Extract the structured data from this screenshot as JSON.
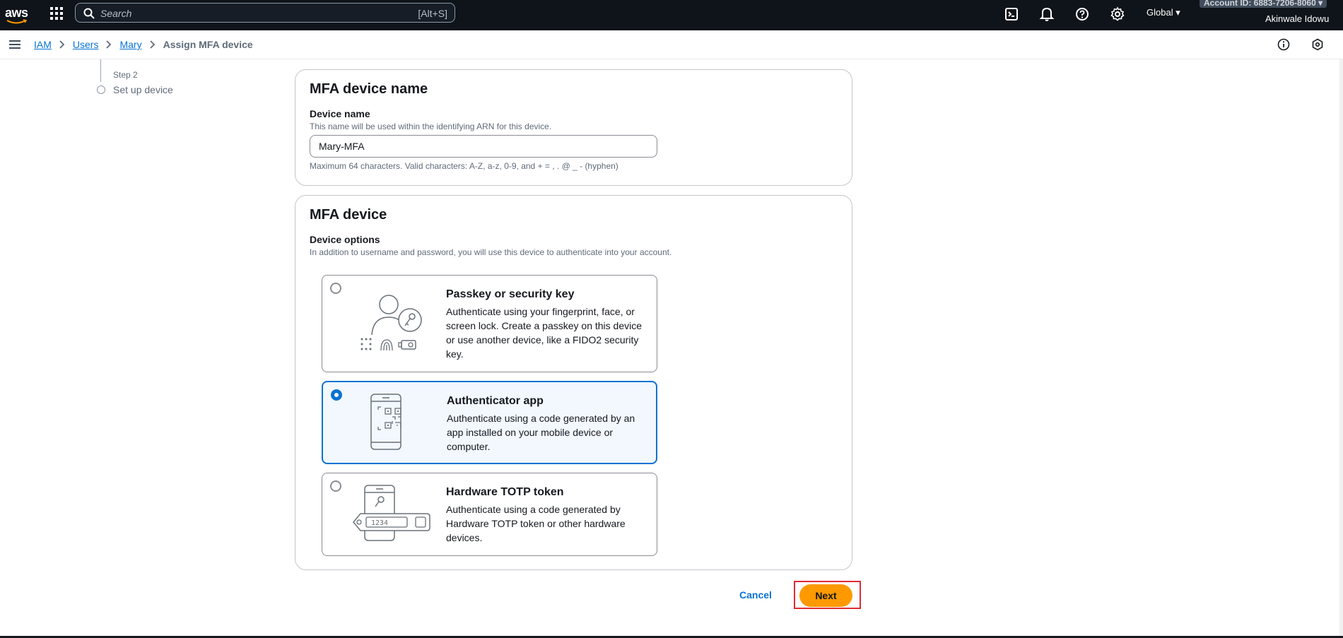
{
  "topnav": {
    "logo_text": "aws",
    "search_placeholder": "Search",
    "search_shortcut": "[Alt+S]",
    "region": "Global ▾",
    "account": "Account ID: 6883-7206-8060 ▾",
    "user": "Akinwale Idowu"
  },
  "breadcrumb": {
    "items": [
      "IAM",
      "Users",
      "Mary"
    ],
    "current": "Assign MFA device"
  },
  "steps": {
    "step_label": "Step 2",
    "step_title": "Set up device"
  },
  "device_name_panel": {
    "heading": "MFA device name",
    "label": "Device name",
    "description": "This name will be used within the identifying ARN for this device.",
    "value": "Mary-MFA",
    "constraint": "Maximum 64 characters. Valid characters: A-Z, a-z, 0-9, and + = , . @ _ - (hyphen)"
  },
  "device_panel": {
    "heading": "MFA device",
    "label": "Device options",
    "description": "In addition to username and password, you will use this device to authenticate into your account.",
    "options": [
      {
        "title": "Passkey or security key",
        "description": "Authenticate using your fingerprint, face, or screen lock. Create a passkey on this device or use another device, like a FIDO2 security key.",
        "selected": false
      },
      {
        "title": "Authenticator app",
        "description": "Authenticate using a code generated by an app installed on your mobile device or computer.",
        "selected": true
      },
      {
        "title": "Hardware TOTP token",
        "description": "Authenticate using a code generated by Hardware TOTP token or other hardware devices.",
        "selected": false
      }
    ],
    "token_display": "1234"
  },
  "actions": {
    "cancel": "Cancel",
    "next": "Next"
  },
  "colors": {
    "nav_bg": "#0f141a",
    "link": "#0972d3",
    "primary_button": "#ff9900",
    "highlight_outline": "#e02b35"
  }
}
